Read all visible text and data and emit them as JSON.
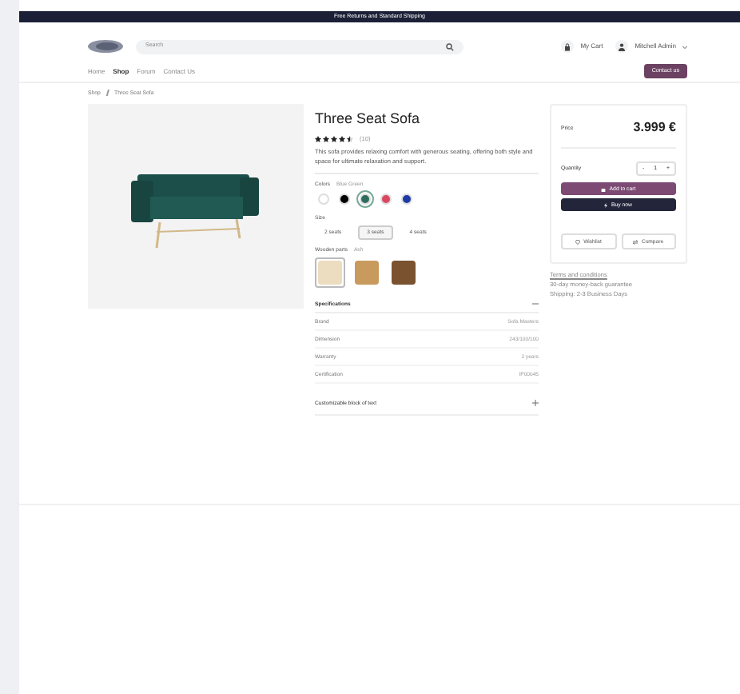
{
  "announcement": "Free Returns and Standard Shipping",
  "header": {
    "search": {
      "placeholder": "Search"
    },
    "cart": "My Cart",
    "user": "Mitchell Admin"
  },
  "nav": [
    {
      "label": "Home",
      "selected": false
    },
    {
      "label": "Shop",
      "selected": true
    },
    {
      "label": "Forum",
      "selected": false
    },
    {
      "label": "Contact Us",
      "selected": false
    }
  ],
  "contact_button": "Contact us",
  "breadcrumb": [
    "Shop",
    "Three Seat Sofa"
  ],
  "product": {
    "title": "Three Seat Sofa",
    "stars": 4.5,
    "rating_count": "(10)",
    "description": "This sofa provides relaxing comfort with generous seating, offering both style and space for ultimate relaxation and support.",
    "colors": {
      "label": "Colors",
      "value": "Blue Green",
      "options": [
        {
          "color": "#ffffff",
          "selected": false
        },
        {
          "color": "#000000",
          "selected": false
        },
        {
          "color": "#2e6b5e",
          "selected": true
        },
        {
          "color": "#d9485f",
          "selected": false
        },
        {
          "color": "#1f3aa6",
          "selected": false
        }
      ]
    },
    "size": {
      "label": "Size",
      "options": [
        {
          "label": "2 seats",
          "selected": false
        },
        {
          "label": "3 seats",
          "selected": true
        },
        {
          "label": "4 seats",
          "selected": false
        }
      ]
    },
    "wood": {
      "label": "Wooden parts",
      "value": "Ash",
      "options": [
        {
          "color": "#ecdcc0",
          "selected": true
        },
        {
          "color": "#c99a5e",
          "selected": false
        },
        {
          "color": "#7a5230",
          "selected": false
        }
      ]
    },
    "specifications": {
      "title": "Specifications",
      "expanded": true,
      "rows": [
        {
          "name": "Brand",
          "value": "Sofa Masters"
        },
        {
          "name": "Dimension",
          "value": "243/100/100"
        },
        {
          "name": "Warranty",
          "value": "2 years"
        },
        {
          "name": "Certification",
          "value": "IP00045"
        }
      ]
    },
    "custom_block": {
      "title": "Customizable block of text",
      "expanded": false
    }
  },
  "buy_box": {
    "price_label": "Price",
    "price": "3.999 €",
    "quantity_label": "Quantity",
    "quantity": "1",
    "minus": "-",
    "plus": "+",
    "add_to_cart": "Add to cart",
    "buy_now": "Buy now",
    "wishlist": "Wishlist",
    "compare": "Compare"
  },
  "info_lines": [
    "Terms and conditions",
    "30-day money-back guarantee",
    "Shipping: 2-3 Business Days"
  ]
}
